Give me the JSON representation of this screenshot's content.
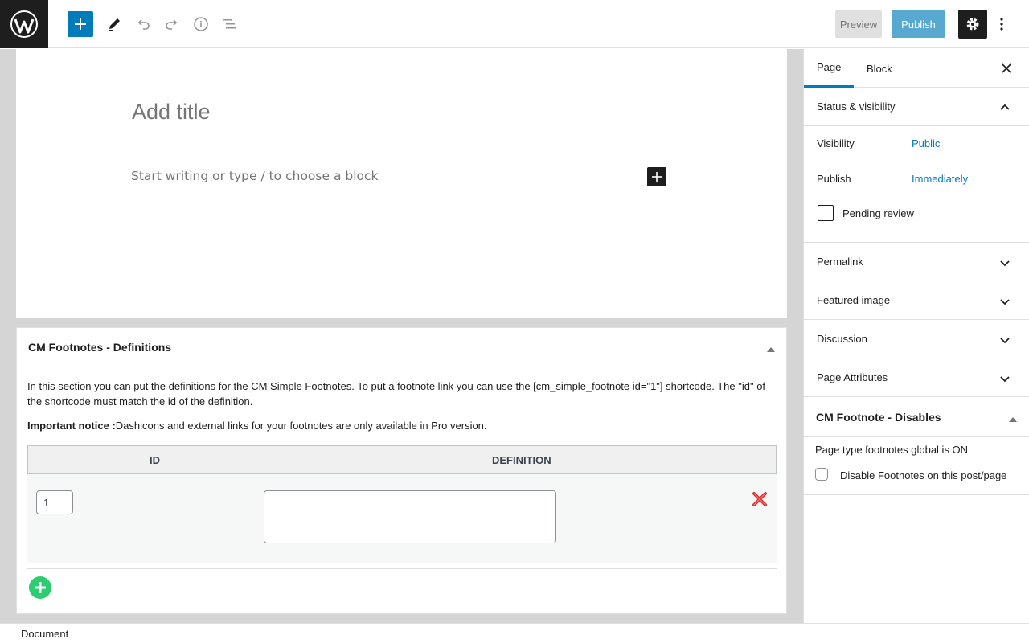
{
  "toolbar": {
    "preview_label": "Preview",
    "publish_label": "Publish"
  },
  "editor": {
    "title_placeholder": "Add title",
    "block_placeholder": "Start writing or type / to choose a block"
  },
  "metabox": {
    "title": "CM Footnotes - Definitions",
    "description": "In this section you can put the definitions for the CM Simple Footnotes. To put a footnote link you can use the [cm_simple_footnote id=\"1\"] shortcode. The \"id\" of the shortcode must match the id of the definition.",
    "notice_label": "Important notice :",
    "notice_text": "Dashicons and external links for your footnotes are only available in Pro version.",
    "table": {
      "headers": [
        "ID",
        "DEFINITION"
      ],
      "rows": [
        {
          "id": "1",
          "definition": ""
        }
      ]
    }
  },
  "footer": {
    "breadcrumb": "Document"
  },
  "sidebar": {
    "tabs": [
      "Page",
      "Block"
    ],
    "status_visibility": {
      "title": "Status & visibility",
      "visibility_label": "Visibility",
      "visibility_value": "Public",
      "publish_label": "Publish",
      "publish_value": "Immediately",
      "pending_label": "Pending review"
    },
    "panels": [
      "Permalink",
      "Featured image",
      "Discussion",
      "Page Attributes"
    ],
    "cm_disables": {
      "title": "CM Footnote - Disables",
      "status": "Page type footnotes global is ON",
      "checkbox_label": "Disable Footnotes on this post/page"
    }
  },
  "colors": {
    "accent": "#007cba",
    "dark": "#1e1e1e",
    "add_green": "#2ecc71",
    "remove_red": "#d63638"
  }
}
